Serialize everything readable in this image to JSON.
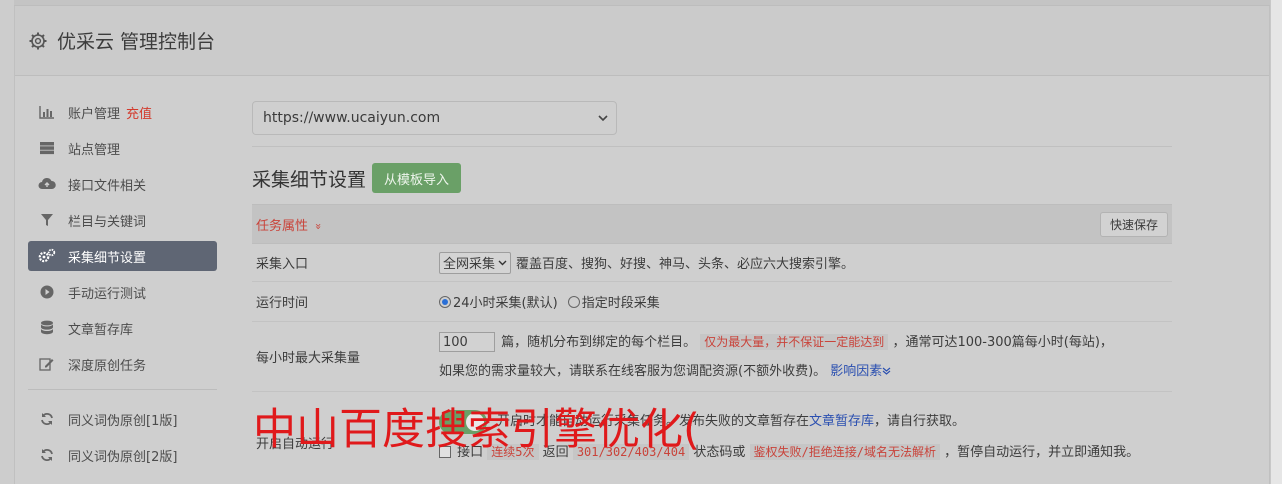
{
  "header": {
    "title": "优采云 管理控制台"
  },
  "sidebar": {
    "items": [
      {
        "label": "账户管理",
        "tag": "充值",
        "icon": "bar-chart-icon"
      },
      {
        "label": "站点管理",
        "icon": "server-icon"
      },
      {
        "label": "接口文件相关",
        "icon": "cloud-upload-icon"
      },
      {
        "label": "栏目与关键词",
        "icon": "filter-icon"
      },
      {
        "label": "采集细节设置",
        "icon": "gears-icon",
        "active": true
      },
      {
        "label": "手动运行测试",
        "icon": "play-circle-icon"
      },
      {
        "label": "文章暂存库",
        "icon": "database-icon"
      },
      {
        "label": "深度原创任务",
        "icon": "edit-icon"
      },
      {
        "label": "同义词伪原创[1版]",
        "icon": "refresh-icon"
      },
      {
        "label": "同义词伪原创[2版]",
        "icon": "refresh-icon"
      }
    ]
  },
  "main": {
    "site_select": {
      "value": "https://www.ucaiyun.com"
    },
    "section_title": "采集细节设置",
    "import_button": "从模板导入",
    "attr_label": "任务属性",
    "attr_chevron": "»",
    "quick_save": "快速保存",
    "rows": {
      "entry": {
        "label": "采集入口",
        "select_value": "全网采集",
        "desc": "覆盖百度、搜狗、好搜、神马、头条、必应六大搜索引擎。"
      },
      "runtime": {
        "label": "运行时间",
        "opt1": "24小时采集(默认)",
        "opt2": "指定时段采集"
      },
      "max": {
        "label": "每小时最大采集量",
        "value": "100",
        "t1": "篇，随机分布到绑定的每个栏目。",
        "warn": "仅为最大量，并不保证一定能达到",
        "t2": "，通常可达100-300篇每小时(每站)，",
        "t3": "如果您的需求量较大，请联系在线客服为您调配资源(不额外收费)。",
        "link": "影响因素"
      },
      "auto": {
        "label": "开启自动运行",
        "line1a": "开启时才能自动运行采集任务。发布失败的文章暂存在",
        "line1link": "文章暂存库",
        "line1b": "，请自行获取。",
        "line2a": "接口",
        "warn1": "连续5次",
        "line2b": "返回",
        "warn2": "301/302/403/404",
        "line2c": "状态码或",
        "warn3": "鉴权失败/拒绝连接/域名无法解析",
        "line2d": "，暂停自动运行，并立即通知我。"
      }
    }
  },
  "overlay_text": "中山百度搜索引擎优化("
}
